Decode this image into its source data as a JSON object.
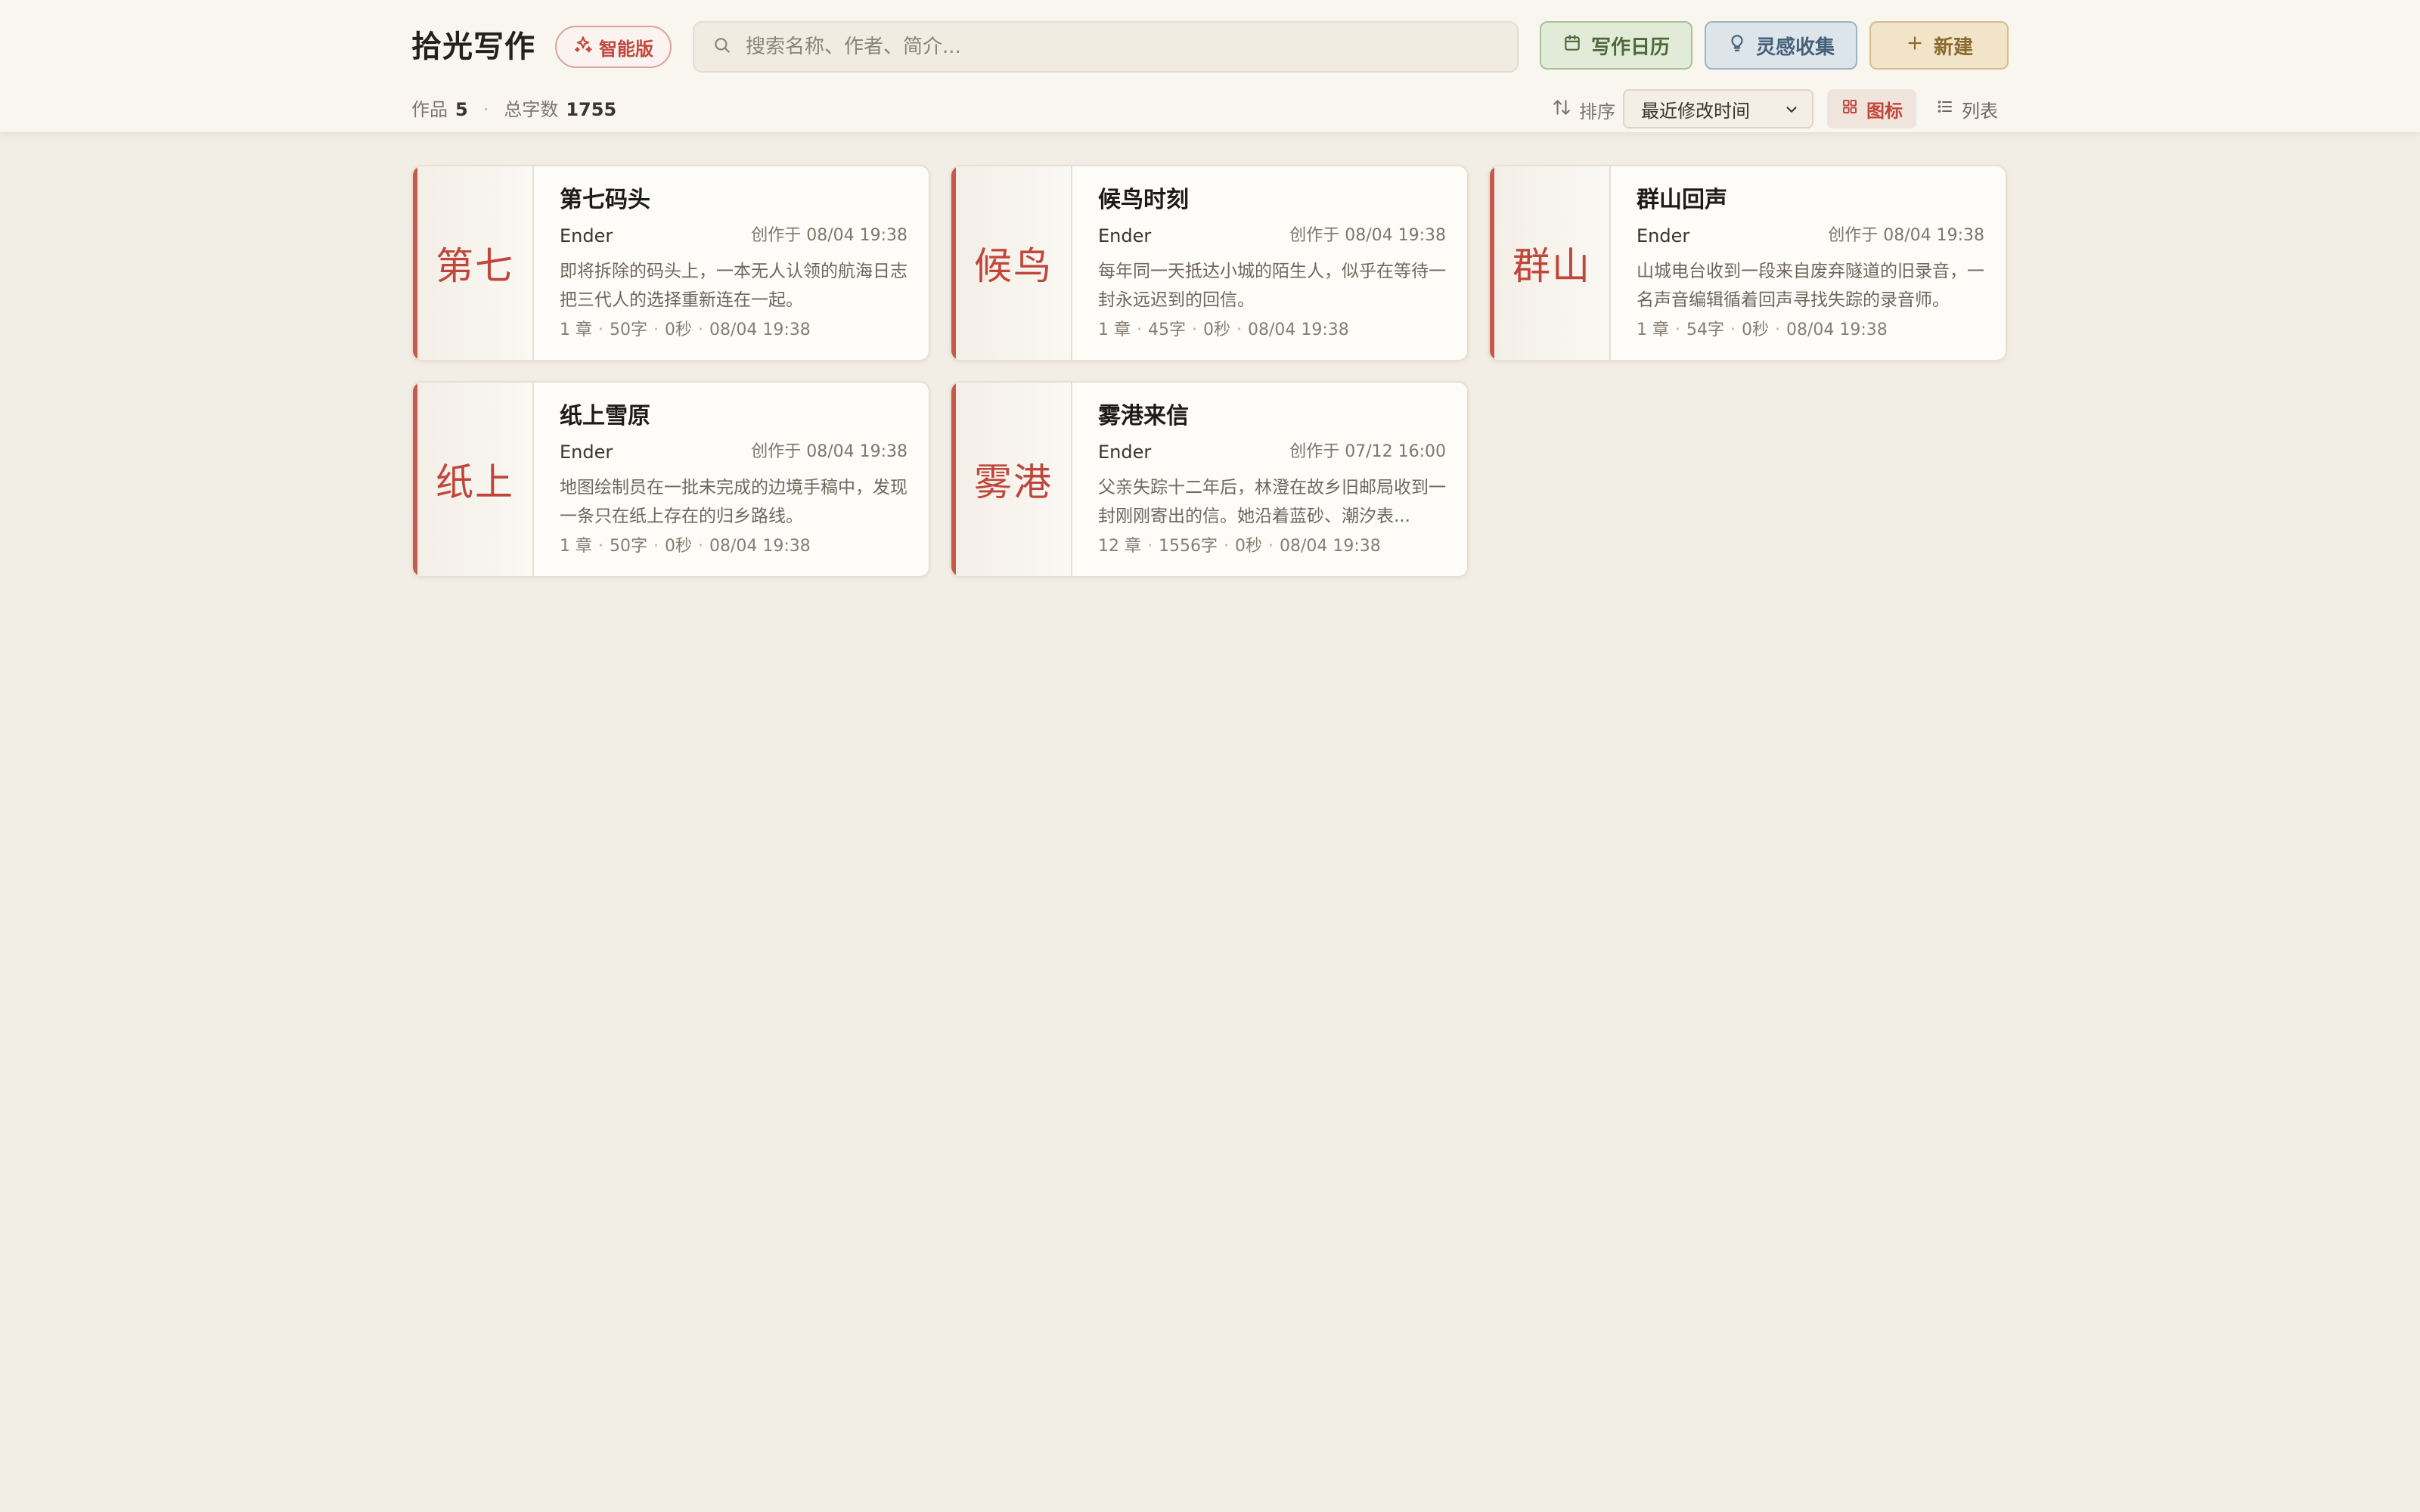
{
  "app": {
    "title": "拾光写作",
    "ai_badge": "智能版"
  },
  "search": {
    "placeholder": "搜索名称、作者、简介..."
  },
  "toolbar": {
    "calendar_label": "写作日历",
    "inspiration_label": "灵感收集",
    "new_label": "新建"
  },
  "summary": {
    "works_label": "作品",
    "works_count": "5",
    "words_label": "总字数",
    "words_count": "1755"
  },
  "sort": {
    "label": "排序",
    "selected": "最近修改时间"
  },
  "view": {
    "grid_label": "图标",
    "list_label": "列表"
  },
  "colors": {
    "accent": "#c0463b",
    "background": "#f2eee6",
    "card": "#fdfcf8"
  },
  "cards": [
    {
      "spine": "第七",
      "title": "第七码头",
      "author": "Ender",
      "created": "创作于 08/04 19:38",
      "summary": "即将拆除的码头上，一本无人认领的航海日志把三代人的选择重新连在一起。",
      "chapters": "1 章",
      "words": "50字",
      "time": "0秒",
      "modified": "08/04 19:38"
    },
    {
      "spine": "候鸟",
      "title": "候鸟时刻",
      "author": "Ender",
      "created": "创作于 08/04 19:38",
      "summary": "每年同一天抵达小城的陌生人，似乎在等待一封永远迟到的回信。",
      "chapters": "1 章",
      "words": "45字",
      "time": "0秒",
      "modified": "08/04 19:38"
    },
    {
      "spine": "群山",
      "title": "群山回声",
      "author": "Ender",
      "created": "创作于 08/04 19:38",
      "summary": "山城电台收到一段来自废弃隧道的旧录音，一名声音编辑循着回声寻找失踪的录音师。",
      "chapters": "1 章",
      "words": "54字",
      "time": "0秒",
      "modified": "08/04 19:38"
    },
    {
      "spine": "纸上",
      "title": "纸上雪原",
      "author": "Ender",
      "created": "创作于 08/04 19:38",
      "summary": "地图绘制员在一批未完成的边境手稿中，发现一条只在纸上存在的归乡路线。",
      "chapters": "1 章",
      "words": "50字",
      "time": "0秒",
      "modified": "08/04 19:38"
    },
    {
      "spine": "雾港",
      "title": "雾港来信",
      "author": "Ender",
      "created": "创作于 07/12 16:00",
      "summary": "父亲失踪十二年后，林澄在故乡旧邮局收到一封刚刚寄出的信。她沿着蓝砂、潮汐表...",
      "chapters": "12 章",
      "words": "1556字",
      "time": "0秒",
      "modified": "08/04 19:38"
    }
  ]
}
